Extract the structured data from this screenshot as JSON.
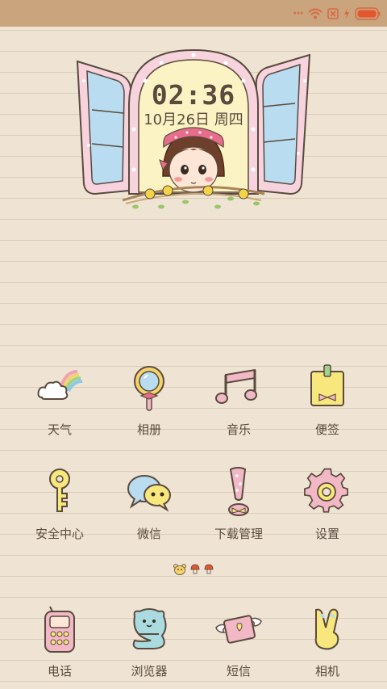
{
  "status_bar": {
    "indicator": "···",
    "icons": [
      "wifi-icon",
      "no-sim-icon",
      "charging-icon",
      "battery-icon"
    ],
    "battery_color": "#e2572e"
  },
  "clock": {
    "time": "02:36",
    "date": "10月26日  周四"
  },
  "apps_page": [
    {
      "label": "天气",
      "icon": "weather-icon"
    },
    {
      "label": "相册",
      "icon": "mirror-gallery-icon"
    },
    {
      "label": "音乐",
      "icon": "music-note-icon"
    },
    {
      "label": "便签",
      "icon": "note-icon"
    },
    {
      "label": "安全中心",
      "icon": "key-security-icon"
    },
    {
      "label": "微信",
      "icon": "wechat-bubbles-icon"
    },
    {
      "label": "下载管理",
      "icon": "download-exclamation-icon"
    },
    {
      "label": "设置",
      "icon": "gear-icon"
    }
  ],
  "page_indicator": {
    "pages": 3,
    "current": 1
  },
  "dock": [
    {
      "label": "电话",
      "icon": "phone-icon"
    },
    {
      "label": "浏览器",
      "icon": "browser-icon"
    },
    {
      "label": "短信",
      "icon": "envelope-wings-icon"
    },
    {
      "label": "相机",
      "icon": "camera-victory-icon"
    }
  ],
  "colors": {
    "background": "#efe4d4",
    "status_bar": "#c9a47c",
    "text": "#5a4a3e",
    "accent_pink": "#f2b8c6",
    "accent_blue": "#b9dcf0",
    "accent_yellow": "#f7e77c"
  }
}
